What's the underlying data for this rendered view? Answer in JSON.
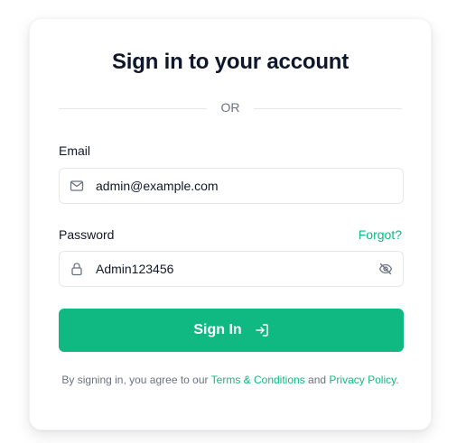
{
  "title": "Sign in to your account",
  "divider_text": "OR",
  "email": {
    "label": "Email",
    "value": "admin@example.com",
    "icon": "mail-icon"
  },
  "password": {
    "label": "Password",
    "value": "Admin123456",
    "forgot_label": "Forgot?",
    "lock_icon": "lock-icon",
    "toggle_icon": "eye-off-icon"
  },
  "submit": {
    "label": "Sign In",
    "icon": "login-arrow-icon"
  },
  "legal": {
    "prefix": "By signing in, you agree to our",
    "terms_link": "Terms & Conditions",
    "conjunction": "and",
    "privacy_link": "Privacy Policy",
    "suffix": "."
  },
  "colors": {
    "accent": "#10b981",
    "title": "#0f172a",
    "muted": "#6b7280",
    "border": "#e5e7eb"
  }
}
